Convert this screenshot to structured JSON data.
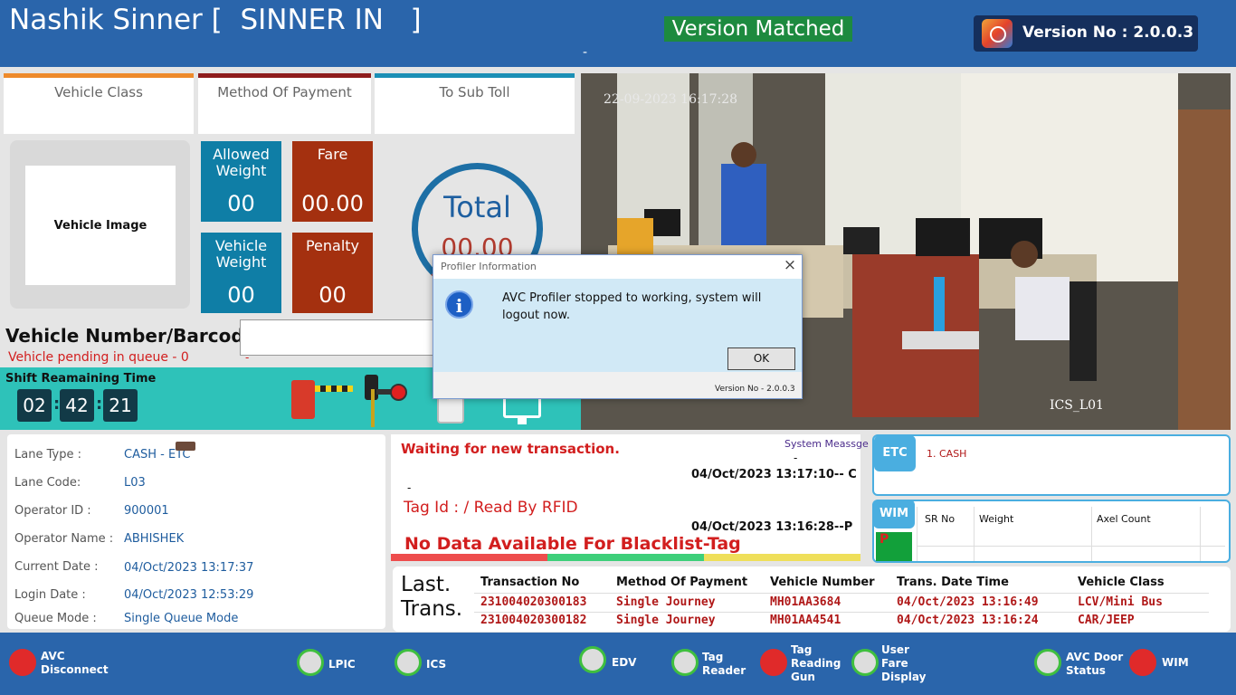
{
  "header": {
    "plaza": "Nashik Sinner [  SINNER IN   ]",
    "version_status": "Version Matched",
    "version_label": "Version No : 2.0.0.3",
    "dash": "-"
  },
  "panels": {
    "vehicle_class": "Vehicle Class",
    "method_of_payment": "Method Of Payment",
    "to_sub_toll": "To Sub Toll"
  },
  "vehicle_image_label": "Vehicle Image",
  "tiles": {
    "allowed_weight": {
      "label": "Allowed Weight",
      "value": "00"
    },
    "fare": {
      "label": "Fare",
      "value": "00.00"
    },
    "vehicle_weight": {
      "label": "Vehicle Weight",
      "value": "00"
    },
    "penalty": {
      "label": "Penalty",
      "value": "00"
    }
  },
  "total": {
    "label": "Total",
    "value": "00.00"
  },
  "vehicle_number": {
    "label": "Vehicle Number/Barcode",
    "value": ""
  },
  "queue_pending": "Vehicle pending in queue - 0",
  "queue_dash": "-",
  "shift": {
    "label": "Shift Reamaining Time",
    "hours": "02",
    "minutes": "42",
    "seconds": "21",
    "sep": ":"
  },
  "camera": {
    "timestamp": "22-09-2023 16:17:28",
    "name": "ICS_L01"
  },
  "dialog": {
    "title": "Profiler Information",
    "close": "×",
    "icon": "i",
    "message": "AVC Profiler stopped to working, system will logout now.",
    "ok": "OK",
    "version": "Version No - 2.0.0.3"
  },
  "lane": {
    "lane_type_label": "Lane Type :",
    "lane_type": "CASH - ETC",
    "lane_code_label": "Lane Code:",
    "lane_code": "L03",
    "operator_id_label": "Operator ID :",
    "operator_id": "900001",
    "operator_name_label": "Operator Name :",
    "operator_name": "ABHISHEK",
    "current_date_label": "Current Date :",
    "current_date": "04/Oct/2023 13:17:37",
    "login_date_label": "Login Date :",
    "login_date": "04/Oct/2023 12:53:29",
    "queue_mode_label": "Queue Mode :",
    "queue_mode": "Single Queue Mode"
  },
  "messages": {
    "waiting": "Waiting for new transaction.",
    "system_label": "System Meassge",
    "sys_dash": "-",
    "ts1": "04/Oct/2023 13:17:10-- C",
    "dash": "-",
    "tag": "Tag Id : / Read By RFID",
    "ts2": "04/Oct/2023 13:16:28--P",
    "blacklist": "No Data Available For Blacklist-Tag"
  },
  "etc": {
    "label": "ETC",
    "entry": "1. CASH"
  },
  "wim": {
    "label": "WIM",
    "indicator": "P",
    "cols": [
      "SR No",
      "Weight",
      "Axel Count"
    ]
  },
  "last_trans": {
    "label1": "Last.",
    "label2": "Trans.",
    "headers": [
      "Transaction No",
      "Method Of Payment",
      "Vehicle Number",
      "Trans. Date Time",
      "Vehicle Class"
    ],
    "rows": [
      [
        "231004020300183",
        "Single Journey",
        "MH01AA3684",
        "04/Oct/2023 13:16:49",
        "LCV/Mini Bus"
      ],
      [
        "231004020300182",
        "Single Journey",
        "MH01AA4541",
        "04/Oct/2023 13:16:24",
        "CAR/JEEP"
      ]
    ]
  },
  "footer": [
    {
      "icon": "avc-disconnect-icon",
      "label1": "AVC",
      "label2": "Disconnect",
      "label3": ""
    },
    {
      "icon": "lpic-camera-icon",
      "label1": "LPIC",
      "label2": "",
      "label3": ""
    },
    {
      "icon": "ics-camera-icon",
      "label1": "ICS",
      "label2": "",
      "label3": ""
    },
    {
      "icon": "edv-icon",
      "label1": "EDV",
      "label2": "",
      "label3": ""
    },
    {
      "icon": "tag-reader-icon",
      "label1": "Tag",
      "label2": "Reader",
      "label3": ""
    },
    {
      "icon": "tag-reading-gun-icon",
      "label1": "Tag",
      "label2": "Reading",
      "label3": "Gun"
    },
    {
      "icon": "user-fare-display-icon",
      "label1": "User",
      "label2": "Fare",
      "label3": "Display"
    },
    {
      "icon": "avc-door-status-icon",
      "label1": "AVC Door",
      "label2": "Status",
      "label3": ""
    },
    {
      "icon": "wim-icon",
      "label1": "WIM",
      "label2": "",
      "label3": ""
    }
  ]
}
